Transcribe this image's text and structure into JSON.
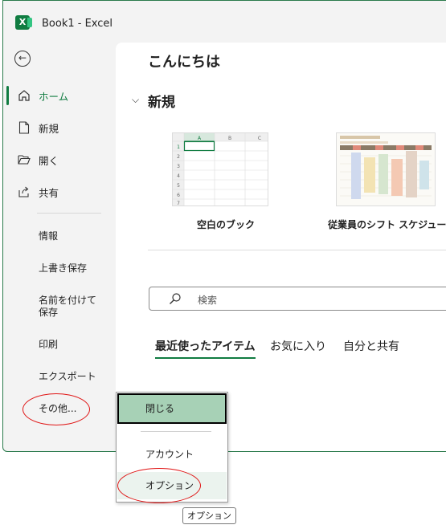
{
  "window": {
    "title": "Book1  -  Excel"
  },
  "sidebar": {
    "items": [
      {
        "label": "ホーム",
        "icon": "home-icon",
        "active": true
      },
      {
        "label": "新規",
        "icon": "new-document-icon"
      },
      {
        "label": "開く",
        "icon": "folder-open-icon"
      },
      {
        "label": "共有",
        "icon": "share-icon"
      }
    ],
    "sub_items": [
      "情報",
      "上書き保存",
      "名前を付けて保存",
      "印刷",
      "エクスポート",
      "その他..."
    ]
  },
  "main": {
    "greeting": "こんにちは",
    "new_section": {
      "title": "新規",
      "templates": [
        {
          "label": "空白のブック",
          "columns": [
            "A",
            "B",
            "C"
          ],
          "rows": [
            "1",
            "2",
            "3",
            "4",
            "5",
            "6",
            "7"
          ]
        },
        {
          "label": "従業員のシフト スケジュール"
        }
      ]
    },
    "search": {
      "placeholder": "検索"
    },
    "tabs": [
      "最近使ったアイテム",
      "お気に入り",
      "自分と共有"
    ]
  },
  "menu": {
    "items": [
      "閉じる",
      "アカウント",
      "オプション"
    ]
  },
  "tooltip": "オプション",
  "colors": {
    "accent": "#107c41",
    "highlight": "#a7d1b6",
    "annotation": "#e01515"
  }
}
